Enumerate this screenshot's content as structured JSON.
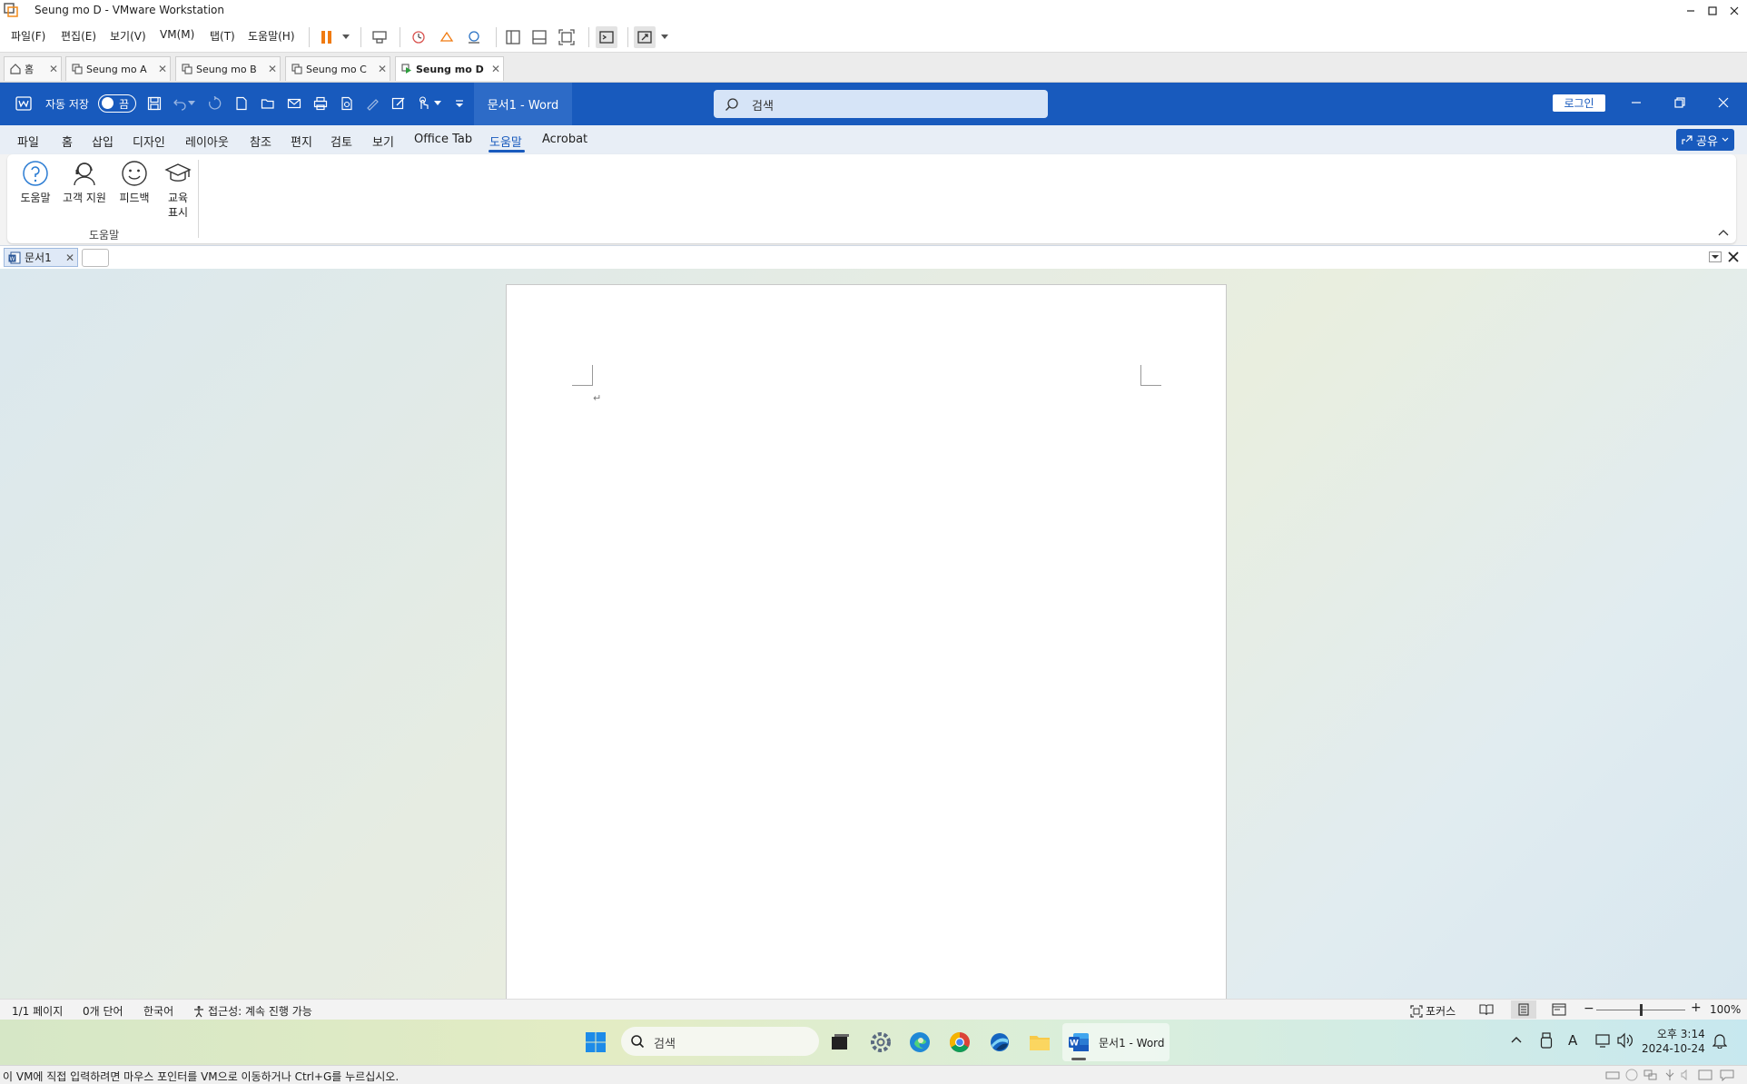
{
  "vmware": {
    "window_title": "Seung mo D - VMware Workstation",
    "menu": [
      "파일(F)",
      "편집(E)",
      "보기(V)",
      "VM(M)",
      "탭(T)",
      "도움말(H)"
    ],
    "tabs": [
      {
        "label": "홈"
      },
      {
        "label": "Seung mo A"
      },
      {
        "label": "Seung mo B"
      },
      {
        "label": "Seung mo C"
      },
      {
        "label": "Seung mo D"
      }
    ],
    "hint": "이 VM에 직접 입력하려면 마우스 포인터를 VM으로 이동하거나 Ctrl+G를 누르십시오."
  },
  "word": {
    "autosave_label": "자동 저장",
    "autosave_state": "끔",
    "doc_title": "문서1  -  Word",
    "search_placeholder": "검색",
    "login_label": "로그인",
    "share_label": "공유",
    "ribbon_tabs": [
      "파일",
      "홈",
      "삽입",
      "디자인",
      "레이아웃",
      "참조",
      "편지",
      "검토",
      "보기",
      "Office Tab",
      "도움말",
      "Acrobat"
    ],
    "ribbon_active_tab": "도움말",
    "ribbon_buttons": [
      {
        "label": "도움말",
        "icon": "help-icon"
      },
      {
        "label": "고객 지원",
        "icon": "support-icon"
      },
      {
        "label": "피드백",
        "icon": "feedback-icon"
      },
      {
        "label": "교육\n표시",
        "icon": "training-icon"
      }
    ],
    "ribbon_group_label": "도움말",
    "office_tab_doc": "문서1",
    "paragraph_mark": "↵",
    "accent": "#185abd"
  },
  "status": {
    "page": "1/1 페이지",
    "words": "0개 단어",
    "language": "한국어",
    "accessibility": "접근성: 계속 진행 가능",
    "focus": "포커스",
    "zoom": "100%",
    "zoom_percent": 100
  },
  "taskbar": {
    "search_placeholder": "검색",
    "active_app": "문서1 - Word",
    "time": "오후 3:14",
    "date": "2024-10-24"
  }
}
